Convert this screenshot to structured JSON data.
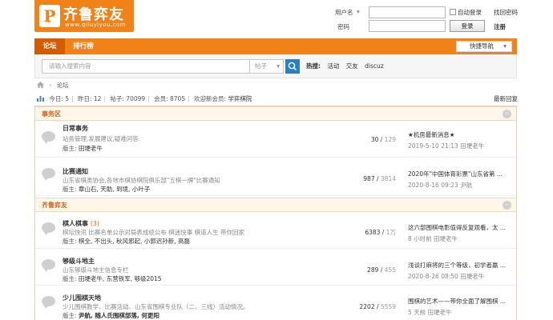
{
  "logo": {
    "mark": "P",
    "name": "齐鲁弈友",
    "domain": "www.qiluyiyou.com",
    "brand_color": "#f08217"
  },
  "login": {
    "username_label": "用户名",
    "password_label": "密码",
    "auto_login": "自动登录",
    "forgot_password": "找回密码",
    "login_button": "登录",
    "register": "注册"
  },
  "nav": {
    "tabs": [
      {
        "label": "论坛",
        "active": true
      },
      {
        "label": "排行榜",
        "active": false
      }
    ],
    "quick_nav": "快捷导航"
  },
  "search": {
    "placeholder": "请输入搜索内容",
    "type": "帖子",
    "hot_label": "热搜:",
    "hot_items": [
      "活动",
      "交友",
      "discuz"
    ]
  },
  "breadcrumb": {
    "current": "论坛"
  },
  "stats": {
    "today": "今日: 5",
    "yesterday": "昨日: 12",
    "posts": "帖子: 70099",
    "members": "会员: 8705",
    "welcome": "欢迎新会员:",
    "new_member": "学弈棋院",
    "latest_reply": "最新回复"
  },
  "categories": [
    {
      "title": "事务区",
      "forums": [
        {
          "name": "日常事务",
          "count": "",
          "desc": "站务管理,发展建议,疑难问答.",
          "mod_label": "版主:",
          "moderators": "田埂老牛",
          "threads": "30",
          "posts": "129",
          "last_title": "★机房最新消息★",
          "last_meta": "2019-5-10 21:13 田埂老牛"
        },
        {
          "name": "比赛通知",
          "count": "",
          "desc": "山东省棋类协会,各地市棋协棋院俱乐部\"五棋一牌\"比赛通知",
          "mod_label": "版主:",
          "moderators": "章山石, 天助, 到境, 小叶子",
          "threads": "987",
          "posts": "3814",
          "last_title": "2020年\"中国体育彩票\"山东省第 ...",
          "last_meta": "2020-8-16 09:23 尹航"
        }
      ]
    },
    {
      "title": "齐鲁弈友",
      "forums": [
        {
          "name": "棋人棋事",
          "count": "(3)",
          "desc": "棋坛快讯 比赛名单公示对局表成绩公布 棋迷快事 棋道人生 带你回家",
          "mod_label": "版主:",
          "moderators": "棋全, 不出头, 秋风邪起, 小郭迟孙新, 高磊",
          "threads": "6383",
          "posts": "1万",
          "last_title": "这六部围棋电影值得反复观看，太 ...",
          "last_meta": "8 小时前 田埂老牛"
        },
        {
          "name": "够级斗地主",
          "count": "",
          "desc": "山东够级斗地主信息专栏",
          "mod_label": "版主:",
          "moderators": "田埂老牛, 东营铁军, 够级2015",
          "threads": "289",
          "posts": "455",
          "last_title": "浅谈打麻将的三个等级，初学者赢 ...",
          "last_meta": "2020-8-26 08:50 田埂老牛"
        },
        {
          "name": "少儿围棋天地",
          "count": "",
          "desc": "少儿围棋教学、比赛活动、山东省围棋专业队（二、三线）活动情况。",
          "mod_label": "版主:",
          "moderators": "尹航, 随人氏围棋部落, 何更阳",
          "threads": "2202",
          "posts": "5559",
          "last_title": "围棋的艺术——带你全面了解围棋 ...",
          "last_meta": "5 天前 田埂老牛"
        }
      ]
    }
  ]
}
